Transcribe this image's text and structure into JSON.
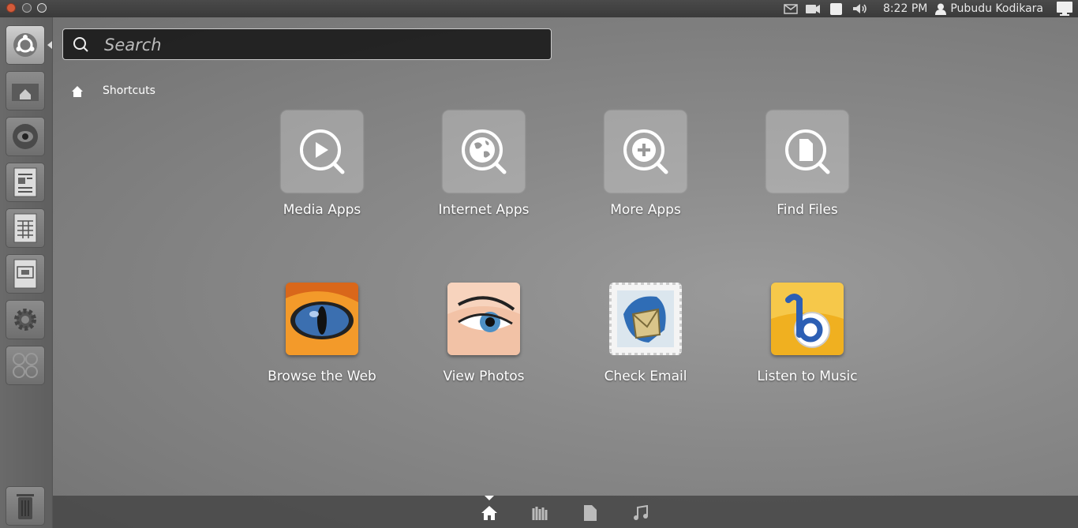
{
  "panel": {
    "clock": "8:22 PM",
    "user_name": "Pubudu Kodikara"
  },
  "search": {
    "placeholder": "Search"
  },
  "filter": {
    "label": "Shortcuts"
  },
  "lenses": [
    {
      "label": "Media Apps",
      "icon": "play-search-icon"
    },
    {
      "label": "Internet Apps",
      "icon": "globe-search-icon"
    },
    {
      "label": "More Apps",
      "icon": "plus-search-icon"
    },
    {
      "label": "Find Files",
      "icon": "file-search-icon"
    }
  ],
  "shortcuts": [
    {
      "label": "Browse the Web",
      "icon": "firefox-eye-icon"
    },
    {
      "label": "View Photos",
      "icon": "eye-photo-icon"
    },
    {
      "label": "Check Email",
      "icon": "thunderbird-stamp-icon"
    },
    {
      "label": "Listen to Music",
      "icon": "banshee-note-icon"
    }
  ],
  "launcher": [
    "dash-button",
    "home-folder",
    "eye-app",
    "writer",
    "calc",
    "impress",
    "settings",
    "workspaces",
    "trash"
  ],
  "lens_bar": [
    "home-lens",
    "applications-lens",
    "files-lens",
    "music-lens"
  ],
  "colors": {
    "panel_bg": "#3a3a3a",
    "tile_bg": "#c8c8c8",
    "text": "#ffffff"
  }
}
